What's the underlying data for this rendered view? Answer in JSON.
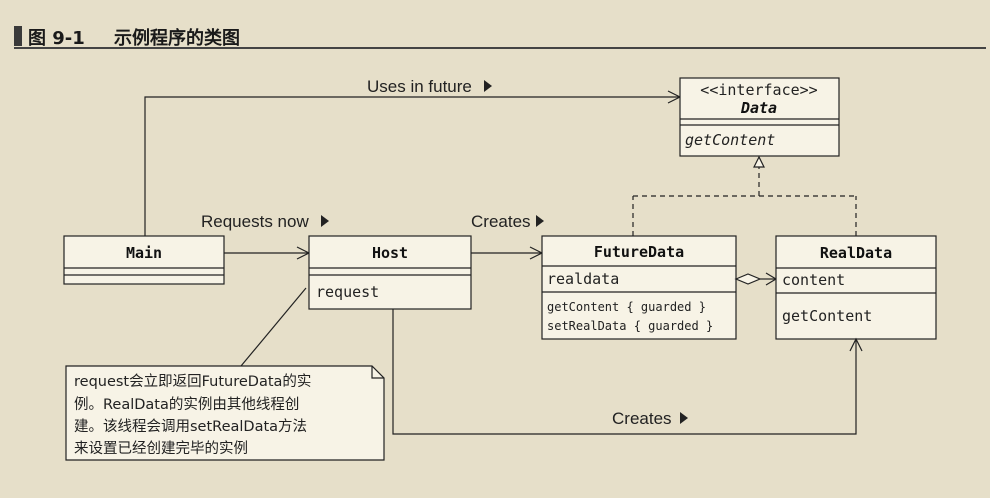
{
  "caption": {
    "number": "图 9-1",
    "title": "示例程序的类图"
  },
  "labels": {
    "uses_in_future": "Uses in future",
    "requests_now": "Requests now",
    "creates_future": "Creates",
    "creates_real": "Creates"
  },
  "classes": {
    "data": {
      "stereotype": "<<interface>>",
      "name": "Data",
      "methods": [
        "getContent"
      ]
    },
    "main": {
      "name": "Main"
    },
    "host": {
      "name": "Host",
      "fields": [
        "request"
      ]
    },
    "futuredata": {
      "name": "FutureData",
      "fields": [
        "realdata"
      ],
      "methods": [
        "getContent { guarded }",
        "setRealData { guarded }"
      ]
    },
    "realdata": {
      "name": "RealData",
      "fields": [
        "content"
      ],
      "methods": [
        "getContent"
      ]
    }
  },
  "note": {
    "lines": [
      "request会立即返回FutureData的实",
      "例。RealData的实例由其他线程创",
      "建。该线程会调用setRealData方法",
      "来设置已经创建完毕的实例"
    ]
  }
}
